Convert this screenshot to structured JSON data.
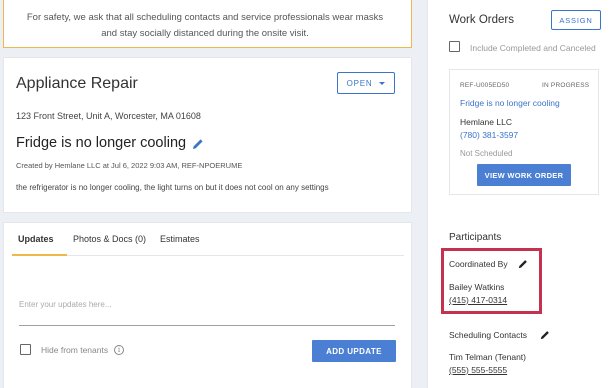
{
  "banner": {
    "text": "For safety, we ask that all scheduling contacts and service professionals wear masks and stay socially distanced during the onsite visit."
  },
  "job": {
    "title": "Appliance Repair",
    "status_label": "OPEN",
    "address": "123 Front Street, Unit A, Worcester, MA 01608",
    "headline": "Fridge is no longer cooling",
    "created": "Created by Hemlane LLC at Jul 6, 2022 9:03 AM, REF-NPOERUME",
    "description": "the refrigerator is no longer cooling, the light turns on but it does not cool on any settings"
  },
  "updates": {
    "tabs": [
      "Updates",
      "Photos & Docs (0)",
      "Estimates"
    ],
    "input_placeholder": "Enter your updates here...",
    "hide_label": "Hide from tenants",
    "add_button": "ADD UPDATE"
  },
  "work_orders": {
    "heading": "Work Orders",
    "assign_label": "ASSIGN",
    "include_completed_label": "Include Completed and Canceled",
    "card": {
      "ref": "REF-U005ED50",
      "status": "IN PROGRESS",
      "title": "Fridge is no longer cooling",
      "vendor": "Hemlane LLC",
      "phone": "(780) 381-3597",
      "schedule": "Not Scheduled",
      "view_button": "VIEW WORK ORDER"
    }
  },
  "participants": {
    "heading": "Participants",
    "coordinated_by_label": "Coordinated By",
    "coordinator_name": "Bailey Watkins",
    "coordinator_phone": "(415) 417-0314",
    "scheduling_contacts_label": "Scheduling Contacts",
    "contact_name": "Tim Telman (Tenant)",
    "contact_phone": "(555) 555-5555"
  },
  "colors": {
    "accent": "#3b74c9",
    "button": "#4a7fd4",
    "banner_border": "#f0b84a",
    "highlight": "#c4324f"
  },
  "icons": [
    "pencil-icon",
    "caret-down-icon",
    "info-icon"
  ]
}
